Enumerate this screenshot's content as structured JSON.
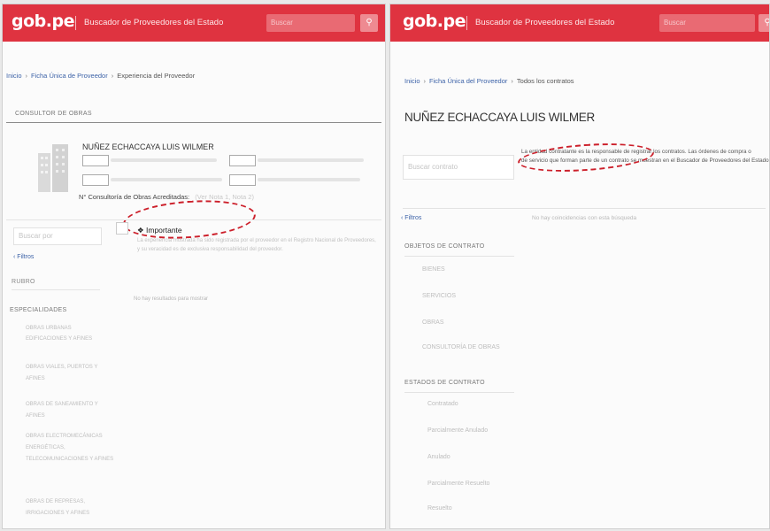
{
  "left": {
    "header": {
      "logo": "gob.pe",
      "title": "Buscador de Proveedores del Estado",
      "search_placeholder": "Buscar"
    },
    "breadcrumb": {
      "home": "Inicio",
      "ficha": "Ficha Única de Proveedor",
      "current": "Experiencia del Proveedor"
    },
    "section_label": "CONSULTOR DE OBRAS",
    "provider_name": "NUÑEZ ECHACCAYA LUIS WILMER",
    "consultorias_label": "N° Consultoría de Obras Acreditadas:",
    "consultorias_suffix": "(Ver Nota 1, Nota 2)",
    "search_placeholder": "Buscar por",
    "filters_label": "Filtros",
    "rubro_label": "RUBRO",
    "especialidades_label": "ESPECIALIDADES",
    "especialidades": [
      "OBRAS URBANAS",
      "EDIFICACIONES Y AFINES",
      "OBRAS VIALES, PUERTOS Y AFINES",
      "OBRAS DE SANEAMIENTO Y AFINES",
      "OBRAS ELECTROMECÁNICAS ENERGÉTICAS, TELECOMUNICACIONES Y AFINES",
      "OBRAS DE REPRESAS, IRRIGACIONES Y AFINES"
    ],
    "important_title": "Importante",
    "important_text": "La experiencia mostrada ha sido registrada por el proveedor en el Registro Nacional de Proveedores, y su veracidad es de exclusiva responsabilidad del proveedor.",
    "no_results": "No hay resultados para mostrar"
  },
  "right": {
    "header": {
      "logo": "gob.pe",
      "title": "Buscador de Proveedores del Estado",
      "search_placeholder": "Buscar"
    },
    "breadcrumb": {
      "home": "Inicio",
      "ficha": "Ficha Única del Proveedor",
      "current": "Todos los contratos"
    },
    "provider_name": "NUÑEZ ECHACCAYA LUIS WILMER",
    "search_placeholder": "Buscar contrato",
    "entity_note_line1": "La entidad contratante es la responsable de registrar los contratos. Las órdenes de compra o",
    "entity_note_line2": "de servicio que forman parte de un contrato se muestran en el Buscador de Proveedores del Estado.",
    "filters_label": "Filtros",
    "no_match": "No hay coincidencias con esta búsqueda",
    "objetos_label": "OBJETOS DE CONTRATO",
    "objetos": [
      "BIENES",
      "SERVICIOS",
      "OBRAS",
      "CONSULTORÍA DE OBRAS"
    ],
    "estados_label": "ESTADOS DE CONTRATO",
    "estados": [
      "Contratado",
      "Parcialmente Anulado",
      "Anulado",
      "Parcialmente Resuelto",
      "Resuelto"
    ]
  },
  "colors": {
    "brand_red": "#df3340",
    "annotation_red": "#cc1f2a",
    "link_blue": "#3d63a8"
  }
}
